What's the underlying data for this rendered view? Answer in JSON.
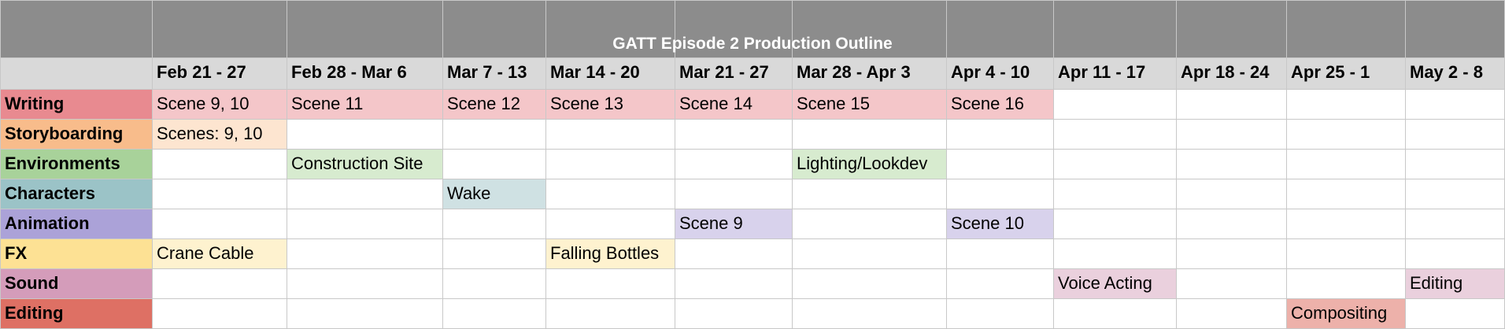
{
  "title": "GATT Episode 2 Production Outline",
  "weeks": [
    "Feb 21 - 27",
    "Feb 28 - Mar 6",
    "Mar 7 - 13",
    "Mar 14 - 20",
    "Mar 21 - 27",
    "Mar 28 - Apr 3",
    "Apr 4 - 10",
    "Apr 11 - 17",
    "Apr 18 - 24",
    "Apr 25 - 1",
    "May 2 - 8"
  ],
  "rows": [
    {
      "label": "Writing",
      "label_color": "#e88a90",
      "cell_color": "#f4c6c9",
      "cells": [
        "Scene 9, 10",
        "Scene 11",
        "Scene 12",
        "Scene 13",
        "Scene 14",
        "Scene 15",
        "Scene 16",
        "",
        "",
        "",
        ""
      ]
    },
    {
      "label": "Storyboarding",
      "label_color": "#f8bc8b",
      "cell_color": "#fde5d0",
      "cells": [
        "Scenes: 9, 10",
        "",
        "",
        "",
        "",
        "",
        "",
        "",
        "",
        "",
        ""
      ]
    },
    {
      "label": "Environments",
      "label_color": "#a8d29a",
      "cell_color": "#d7ebcf",
      "cells": [
        "",
        "Construction Site",
        "",
        "",
        "",
        "Lighting/Lookdev",
        "",
        "",
        "",
        "",
        ""
      ]
    },
    {
      "label": "Characters",
      "label_color": "#9bc3c7",
      "cell_color": "#cfe1e3",
      "cells": [
        "",
        "",
        "Wake",
        "",
        "",
        "",
        "",
        "",
        "",
        "",
        ""
      ]
    },
    {
      "label": "Animation",
      "label_color": "#aba2d8",
      "cell_color": "#d8d2ec",
      "cells": [
        "",
        "",
        "",
        "",
        "Scene 9",
        "",
        "Scene 10",
        "",
        "",
        "",
        ""
      ]
    },
    {
      "label": "FX",
      "label_color": "#fde194",
      "cell_color": "#fef2cf",
      "cells": [
        "Crane Cable",
        "",
        "",
        "Falling Bottles",
        "",
        "",
        "",
        "",
        "",
        "",
        ""
      ]
    },
    {
      "label": "Sound",
      "label_color": "#d49cba",
      "cell_color": "#ead0dd",
      "cells": [
        "",
        "",
        "",
        "",
        "",
        "",
        "",
        "Voice Acting",
        "",
        "",
        "Editing"
      ]
    },
    {
      "label": "Editing",
      "label_color": "#de7064",
      "cell_color": "#edb1aa",
      "cells": [
        "",
        "",
        "",
        "",
        "",
        "",
        "",
        "",
        "",
        "Compositing",
        ""
      ]
    }
  ]
}
